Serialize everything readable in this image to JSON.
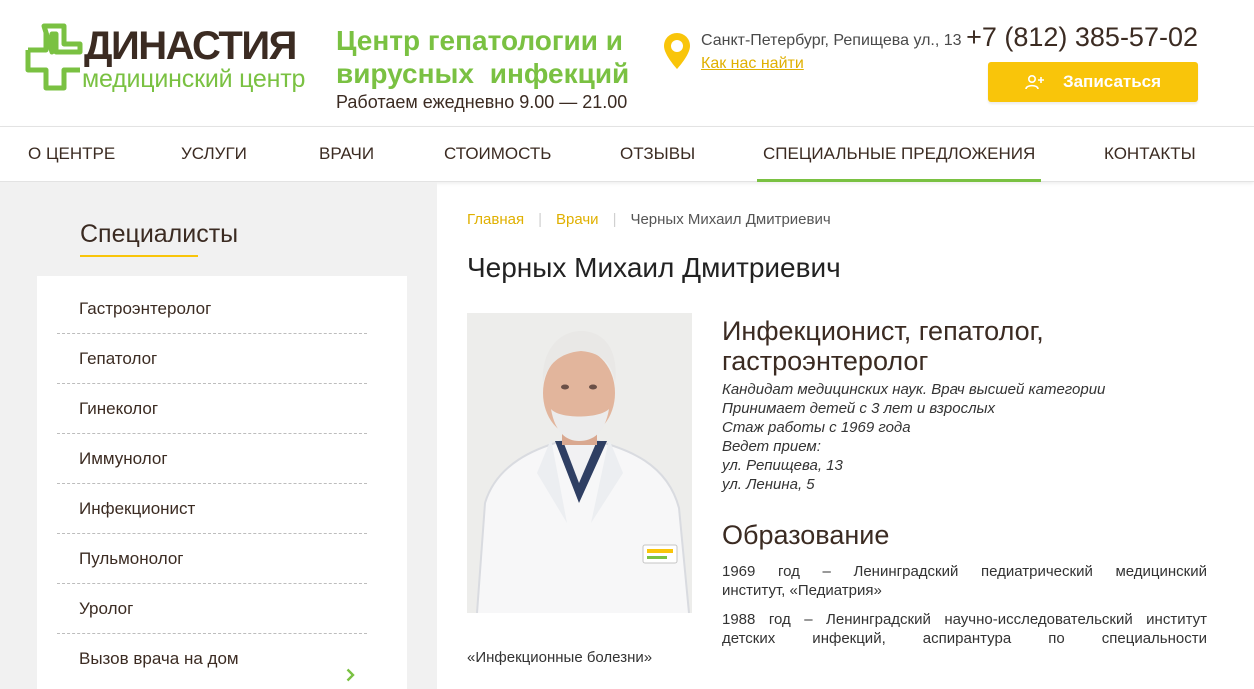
{
  "brand": {
    "name": "ДИНАСТИЯ",
    "subtitle": "медицинский центр",
    "green": "#7ac142",
    "brown": "#3b2b22",
    "accent_yellow": "#f9c50a"
  },
  "header": {
    "center_line1": "Центр гепатологии и",
    "center_line2": "вирусных инфекций",
    "hours": "Работаем ежедневно 9.00 — 21.00",
    "address": "Санкт-Петербург, Репищева ул., 13",
    "find_us": "Как нас найти",
    "phone": "+7 (812) 385-57-02",
    "signup_label": "Записаться",
    "pin_icon": "location-pin-icon",
    "signup_icon": "add-user-icon"
  },
  "nav": {
    "items": [
      {
        "label": "О центре"
      },
      {
        "label": "Услуги"
      },
      {
        "label": "Врачи"
      },
      {
        "label": "Стоимость"
      },
      {
        "label": "Отзывы"
      },
      {
        "label": "Специальные предложения"
      },
      {
        "label": "Контакты"
      }
    ],
    "active": "Специальные предложения"
  },
  "sidebar": {
    "title": "Специалисты",
    "items": [
      {
        "label": "Гастроэнтеролог"
      },
      {
        "label": "Гепатолог"
      },
      {
        "label": "Гинеколог"
      },
      {
        "label": "Иммунолог"
      },
      {
        "label": "Инфекционист"
      },
      {
        "label": "Пульмонолог"
      },
      {
        "label": "Уролог"
      },
      {
        "label": "Вызов врача на дом"
      }
    ]
  },
  "breadcrumb": {
    "home": "Главная",
    "doctors": "Врачи",
    "current": "Черных Михаил Дмитриевич"
  },
  "doctor": {
    "name": "Черных Михаил Дмитриевич",
    "specialty_line1": "Инфекционист, гепатолог,",
    "specialty_line2": "гастроэнтеролог",
    "info": [
      "Кандидат медицинских наук. Врач высшей категории",
      "Принимает детей с 3 лет и взрослых",
      "Стаж работы с 1969 года",
      "Ведет прием:",
      "ул. Репищева, 13",
      "ул. Ленина, 5"
    ],
    "education_title": "Образование",
    "education": [
      {
        "line1": "1969 год – Ленинградский педиатрический медицинский",
        "line2": "институт, «Педиатрия»"
      },
      {
        "line1": "1988 год – Ленинградский научно-исследовательский институт",
        "line2": "детских инфекций, аспирантура по специальности",
        "line3": "«Инфекционные болезни»"
      }
    ]
  }
}
